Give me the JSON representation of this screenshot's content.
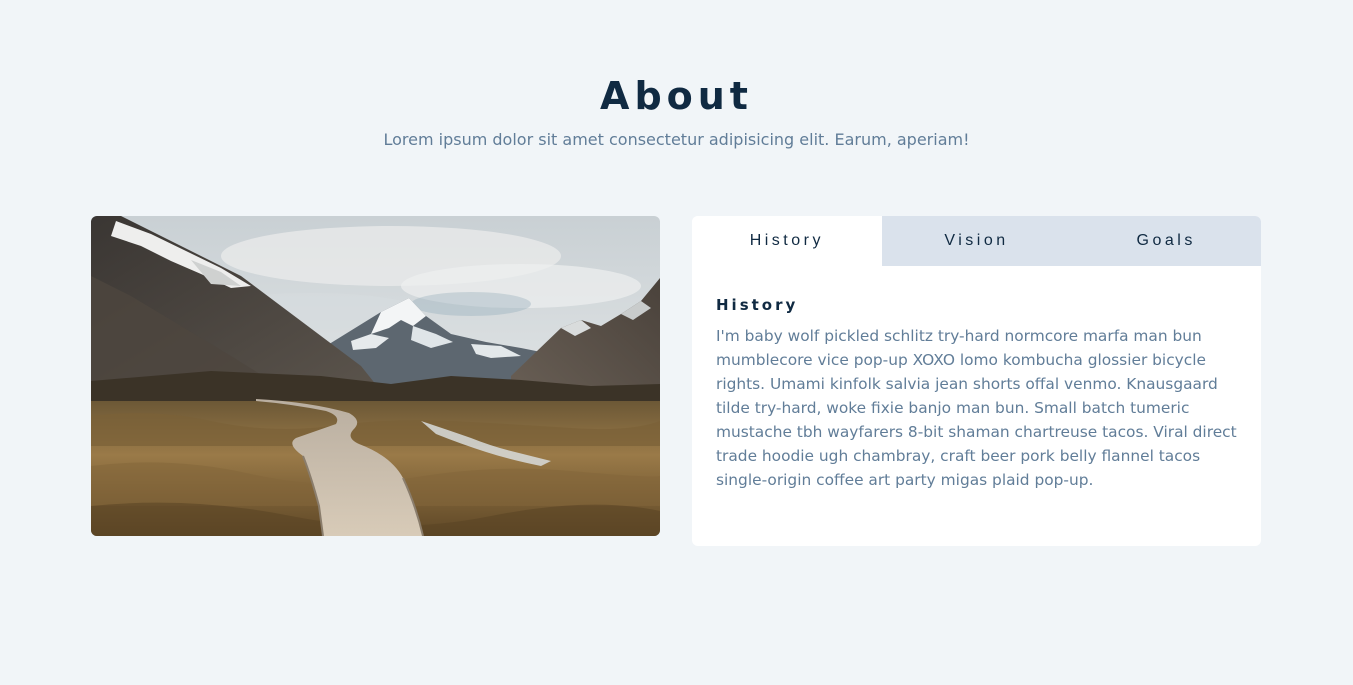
{
  "header": {
    "title": "About",
    "subtitle": "Lorem ipsum dolor sit amet consectetur adipisicing elit. Earum, aperiam!"
  },
  "image": {
    "description": "mountain landscape with wooden boardwalk path"
  },
  "tabs": [
    {
      "label": "History",
      "active": true
    },
    {
      "label": "Vision",
      "active": false
    },
    {
      "label": "Goals",
      "active": false
    }
  ],
  "content": {
    "title": "History",
    "text": "I'm baby wolf pickled schlitz try-hard normcore marfa man bun mumblecore vice pop-up XOXO lomo kombucha glossier bicycle rights. Umami kinfolk salvia jean shorts offal venmo. Knausgaard tilde try-hard, woke fixie banjo man bun. Small batch tumeric mustache tbh wayfarers 8-bit shaman chartreuse tacos. Viral direct trade hoodie ugh chambray, craft beer pork belly flannel tacos single-origin coffee art party migas plaid pop-up."
  },
  "colors": {
    "background": "#f1f5f8",
    "title": "#102a42",
    "text": "#617d98",
    "tab_inactive": "#dae2ec",
    "card": "#ffffff"
  }
}
